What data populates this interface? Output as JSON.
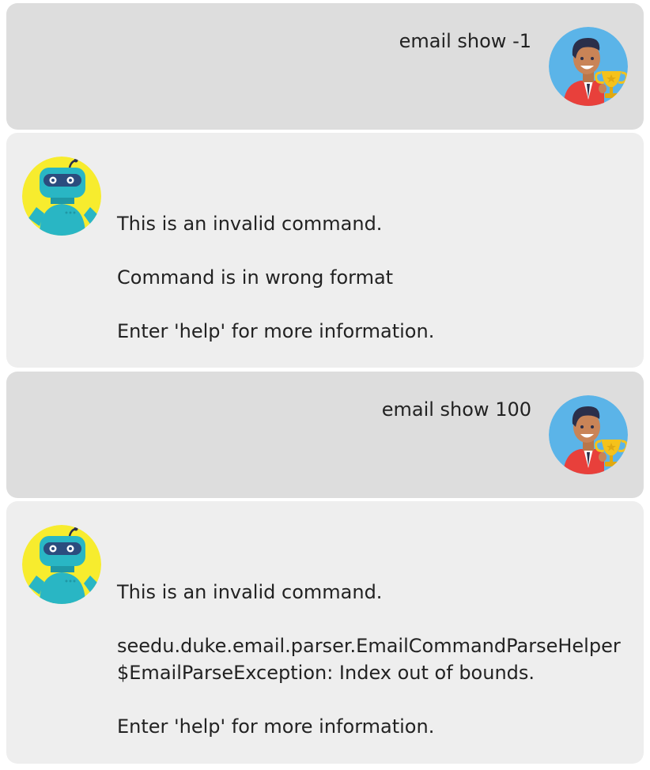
{
  "messages": [
    {
      "sender": "user",
      "text": "email show -1",
      "avatar_icon": "user-trophy-avatar"
    },
    {
      "sender": "bot",
      "avatar_icon": "robot-avatar",
      "lines": [
        "This is an invalid command.",
        "Command is in wrong format",
        "Enter 'help' for more information."
      ]
    },
    {
      "sender": "user",
      "text": "email show 100",
      "avatar_icon": "user-trophy-avatar"
    },
    {
      "sender": "bot",
      "avatar_icon": "robot-avatar",
      "lines": [
        "This is an invalid command.",
        "seedu.duke.email.parser.EmailCommandParseHelper$EmailParseException: Index out of bounds.",
        "Enter 'help' for more information."
      ]
    }
  ],
  "colors": {
    "user_bubble": "#dddddd",
    "bot_bubble": "#eeeeee",
    "text": "#222222",
    "user_avatar_bg": "#5bb4e8",
    "bot_avatar_bg": "#f7ec2e"
  }
}
